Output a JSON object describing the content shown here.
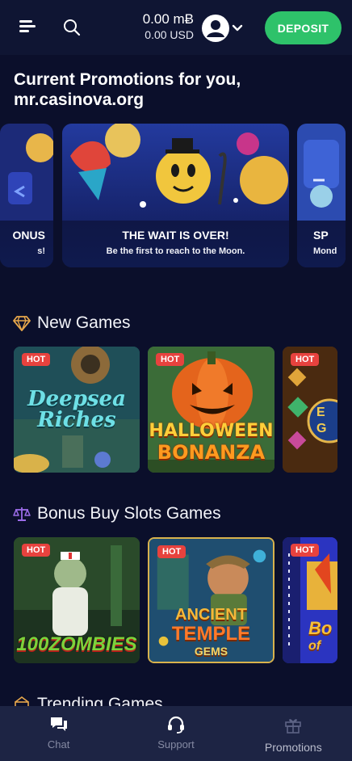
{
  "header": {
    "balance_main": "0.00 mɃ",
    "balance_sub": "0.00 USD",
    "deposit_label": "DEPOSIT"
  },
  "promotions": {
    "title": "Current Promotions for you, mr.casinova.org",
    "cards": [
      {
        "title": "ONUS",
        "subtitle": "s!"
      },
      {
        "title": "THE WAIT IS OVER!",
        "subtitle": "Be the first to reach to the Moon."
      },
      {
        "title": "SP",
        "subtitle": "Mond"
      }
    ]
  },
  "sections": {
    "new_games": "New Games",
    "bonus_buy": "Bonus Buy Slots Games",
    "trending": "Trending Games"
  },
  "badges": {
    "hot": "HOT"
  },
  "new_games": [
    {
      "title_line1": "Deepsea",
      "title_line2": "Riches"
    },
    {
      "title_line1": "HALLOWEEN",
      "title_line2": "BONANZA"
    },
    {
      "title_line1": "E",
      "title_line2": "G"
    }
  ],
  "bonus_buy_games": [
    {
      "title": "100ZOMBIES"
    },
    {
      "title_line1": "ANCIENT",
      "title_line2": "TEMPLE",
      "title_line3": "GEMS"
    },
    {
      "title_line1": "Bo",
      "title_line2": "of"
    }
  ],
  "bottom_nav": {
    "chat": "Chat",
    "support": "Support",
    "promotions": "Promotions"
  },
  "colors": {
    "background": "#0b0f2b",
    "header": "#0f1533",
    "deposit": "#2ec26a",
    "hot": "#e7423e",
    "nav": "#1d2444"
  }
}
